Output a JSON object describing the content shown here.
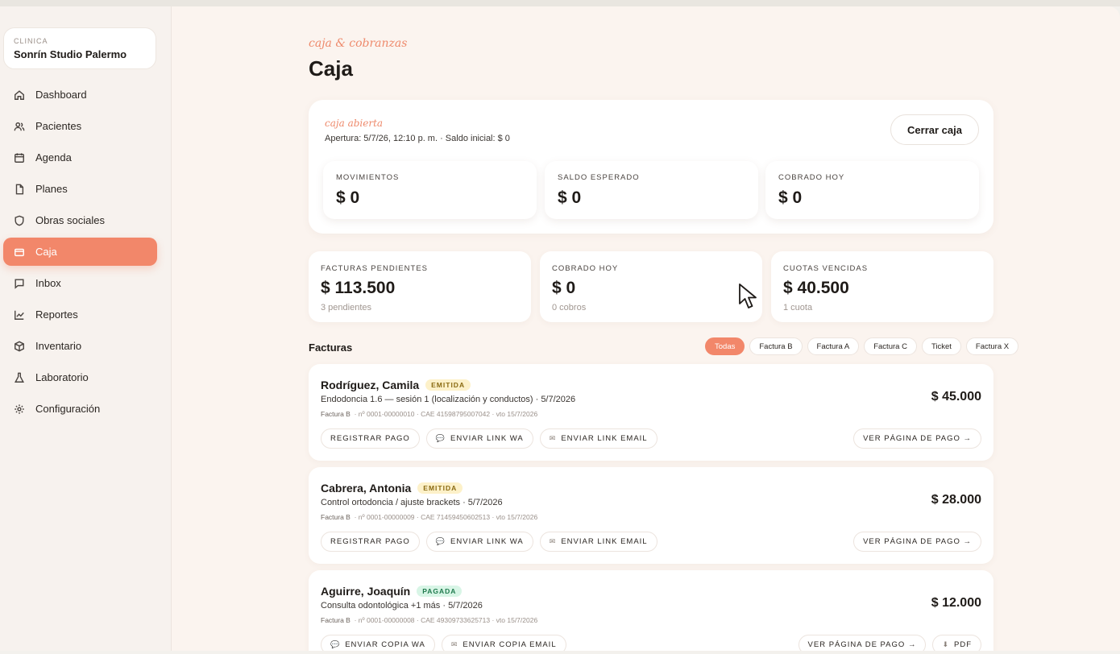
{
  "clinic": {
    "label": "CLINICA",
    "name": "Sonrín Studio Palermo"
  },
  "nav": [
    {
      "label": "Dashboard",
      "icon": "home-icon"
    },
    {
      "label": "Pacientes",
      "icon": "users-icon"
    },
    {
      "label": "Agenda",
      "icon": "calendar-icon"
    },
    {
      "label": "Planes",
      "icon": "file-icon"
    },
    {
      "label": "Obras sociales",
      "icon": "shield-icon"
    },
    {
      "label": "Caja",
      "icon": "wallet-icon",
      "active": true
    },
    {
      "label": "Inbox",
      "icon": "chat-icon"
    },
    {
      "label": "Reportes",
      "icon": "chart-icon"
    },
    {
      "label": "Inventario",
      "icon": "box-icon"
    },
    {
      "label": "Laboratorio",
      "icon": "flask-icon"
    },
    {
      "label": "Configuración",
      "icon": "gear-icon"
    }
  ],
  "header": {
    "kicker": "caja & cobranzas",
    "title": "Caja"
  },
  "caja": {
    "status": "caja abierta",
    "meta": "Apertura: 5/7/26, 12:10 p. m. · Saldo inicial: $ 0",
    "close_label": "Cerrar caja",
    "stats": [
      {
        "label": "MOVIMIENTOS",
        "value": "$ 0"
      },
      {
        "label": "SALDO ESPERADO",
        "value": "$ 0"
      },
      {
        "label": "COBRADO HOY",
        "value": "$ 0"
      }
    ]
  },
  "kpis": [
    {
      "label": "FACTURAS PENDIENTES",
      "value": "$ 113.500",
      "sub": "3 pendientes"
    },
    {
      "label": "COBRADO HOY",
      "value": "$ 0",
      "sub": "0 cobros"
    },
    {
      "label": "CUOTAS VENCIDAS",
      "value": "$ 40.500",
      "sub": "1 cuota"
    }
  ],
  "invoices_section": {
    "title": "Facturas",
    "filters": [
      "Todas",
      "Factura B",
      "Factura A",
      "Factura C",
      "Ticket",
      "Factura X"
    ],
    "active_filter": "Todas"
  },
  "invoices": [
    {
      "name": "Rodríguez, Camila",
      "badge": "EMITIDA",
      "desc": "Endodoncia 1.6 — sesión 1 (localización y conductos) · 5/7/2026",
      "type": "Factura B",
      "meta": "· nº 0001-00000010 · CAE 41598795007042 · vto 15/7/2026",
      "amount": "$ 45.000",
      "actions": [
        "REGISTRAR PAGO",
        "ENVIAR LINK WA",
        "ENVIAR LINK EMAIL"
      ],
      "right_actions": [
        "VER PÁGINA DE PAGO →"
      ]
    },
    {
      "name": "Cabrera, Antonia",
      "badge": "EMITIDA",
      "desc": "Control ortodoncia / ajuste brackets · 5/7/2026",
      "type": "Factura B",
      "meta": "· nº 0001-00000009 · CAE 71459450602513 · vto 15/7/2026",
      "amount": "$ 28.000",
      "actions": [
        "REGISTRAR PAGO",
        "ENVIAR LINK WA",
        "ENVIAR LINK EMAIL"
      ],
      "right_actions": [
        "VER PÁGINA DE PAGO →"
      ]
    },
    {
      "name": "Aguirre, Joaquín",
      "badge": "PAGADA",
      "desc": "Consulta odontológica +1 más · 5/7/2026",
      "type": "Factura B",
      "meta": "· nº 0001-00000008 · CAE 49309733625713 · vto 15/7/2026",
      "amount": "$ 12.000",
      "actions": [
        "ENVIAR COPIA WA",
        "ENVIAR COPIA EMAIL"
      ],
      "right_actions": [
        "VER PÁGINA DE PAGO →",
        "PDF"
      ]
    }
  ],
  "colors": {
    "accent": "#f2876a",
    "background": "#fbf4ef",
    "emitida": "#fdf1c9",
    "pagada": "#d8f5e6"
  }
}
